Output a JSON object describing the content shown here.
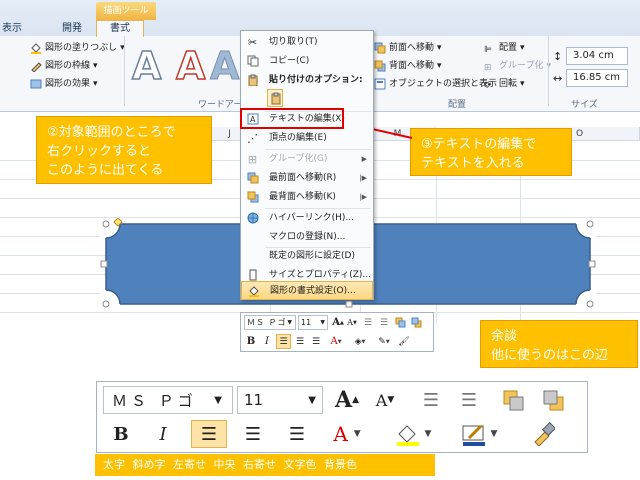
{
  "ribbon": {
    "tabs": {
      "display": "表示",
      "developer": "開発",
      "format": "書式",
      "context": "描画ツール"
    },
    "shape_styles": {
      "fill": "図形の塗りつぶし",
      "outline": "図形の枠線",
      "effects": "図形の効果"
    },
    "wordart_group": "ワードアート",
    "arrange": {
      "bring_forward": "前面へ移動",
      "send_backward": "背面へ移動",
      "selection_pane": "オブジェクトの選択と表示",
      "align": "配置",
      "group": "グループ化",
      "rotate": "回転"
    },
    "arrange_group": "配置",
    "size": {
      "height": "3.04 cm",
      "width": "16.85 cm"
    },
    "size_group": "サイズ"
  },
  "sheet": {
    "columns": [
      "J",
      "M",
      "O"
    ]
  },
  "context_menu": {
    "cut": "切り取り(T)",
    "copy": "コピー(C)",
    "paste_options": "貼り付けのオプション:",
    "edit_text": "テキストの編集(X)",
    "edit_points": "頂点の編集(E)",
    "group": "グループ化(G)",
    "bring_to_front": "最前面へ移動(R)",
    "send_to_back": "最背面へ移動(K)",
    "hyperlink": "ハイパーリンク(H)...",
    "assign_macro": "マクロの登録(N)...",
    "set_default_shape": "既定の図形に設定(D)",
    "size_properties": "サイズとプロパティ(Z)...",
    "format_shape": "図形の書式設定(O)..."
  },
  "callouts": {
    "left": [
      "②対象範囲のところで",
      "右クリックすると",
      "このように出てくる"
    ],
    "right": [
      "③テキストの編集で",
      "テキストを入れる"
    ],
    "side": [
      "余談",
      "他に使うのはこの辺"
    ]
  },
  "mini_toolbar": {
    "font": "ＭＳ Ｐゴ",
    "size": "11"
  },
  "bottom_labels": [
    "太字",
    "斜め字",
    "左寄せ",
    "中央",
    "右寄せ",
    "文字色",
    "背景色"
  ],
  "colors": {
    "accent": "#ffc000",
    "shape_fill": "#4f81bd",
    "shape_border": "#385d8a",
    "highlight": "#e10000"
  }
}
